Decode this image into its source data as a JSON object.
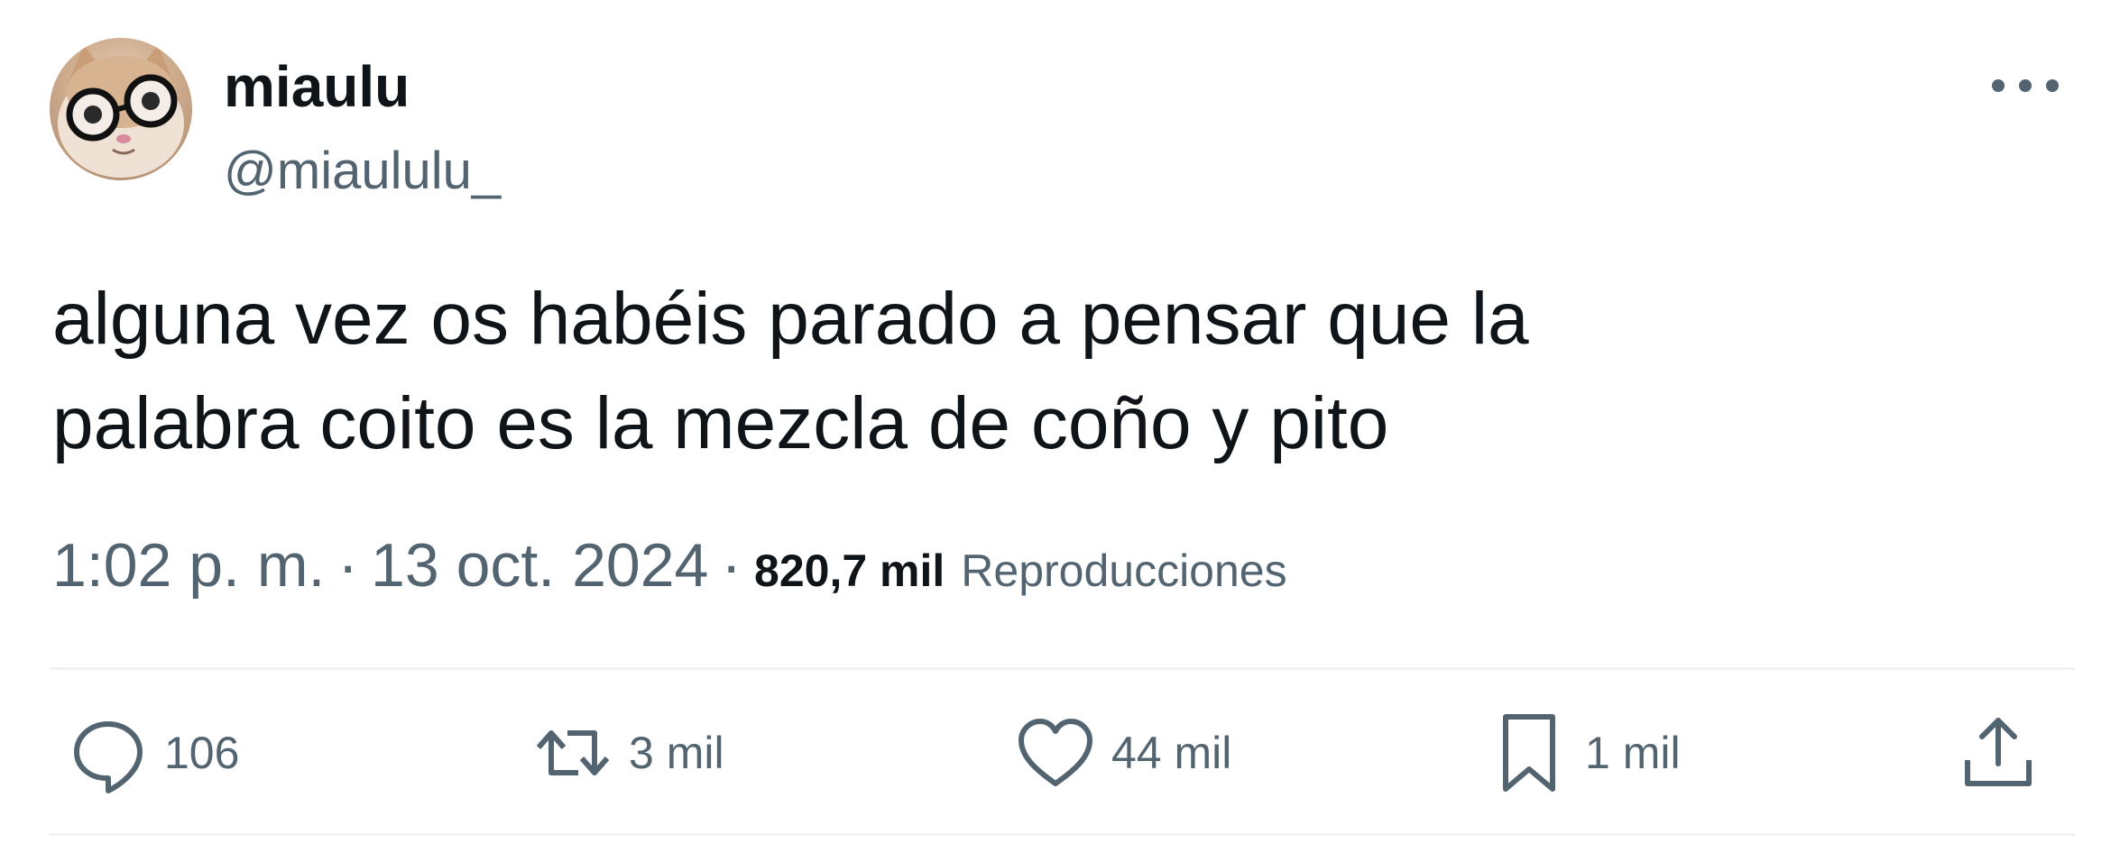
{
  "author": {
    "display_name": "miaulu",
    "handle": "@miaululu_",
    "avatar": "cat-with-glasses-avatar"
  },
  "header": {
    "more_icon": "more-horizontal-icon"
  },
  "tweet": {
    "text_lines": [
      "alguna vez os habéis parado a pensar que la",
      "palabra coito es la mezcla de coño y pito"
    ],
    "time": "1:02 p. m.",
    "date": "13 oct. 2024",
    "separator": "·",
    "views_count": "820,7 mil",
    "views_label": "Reproducciones"
  },
  "actions": {
    "reply": {
      "icon": "reply-icon",
      "count": "106"
    },
    "repost": {
      "icon": "repost-icon",
      "count": "3 mil"
    },
    "like": {
      "icon": "heart-icon",
      "count": "44 mil"
    },
    "bookmark": {
      "icon": "bookmark-icon",
      "count": "1 mil"
    },
    "share": {
      "icon": "share-icon"
    }
  },
  "colors": {
    "text_primary": "#0f1419",
    "text_secondary": "#536471",
    "divider": "#eff3f4"
  }
}
